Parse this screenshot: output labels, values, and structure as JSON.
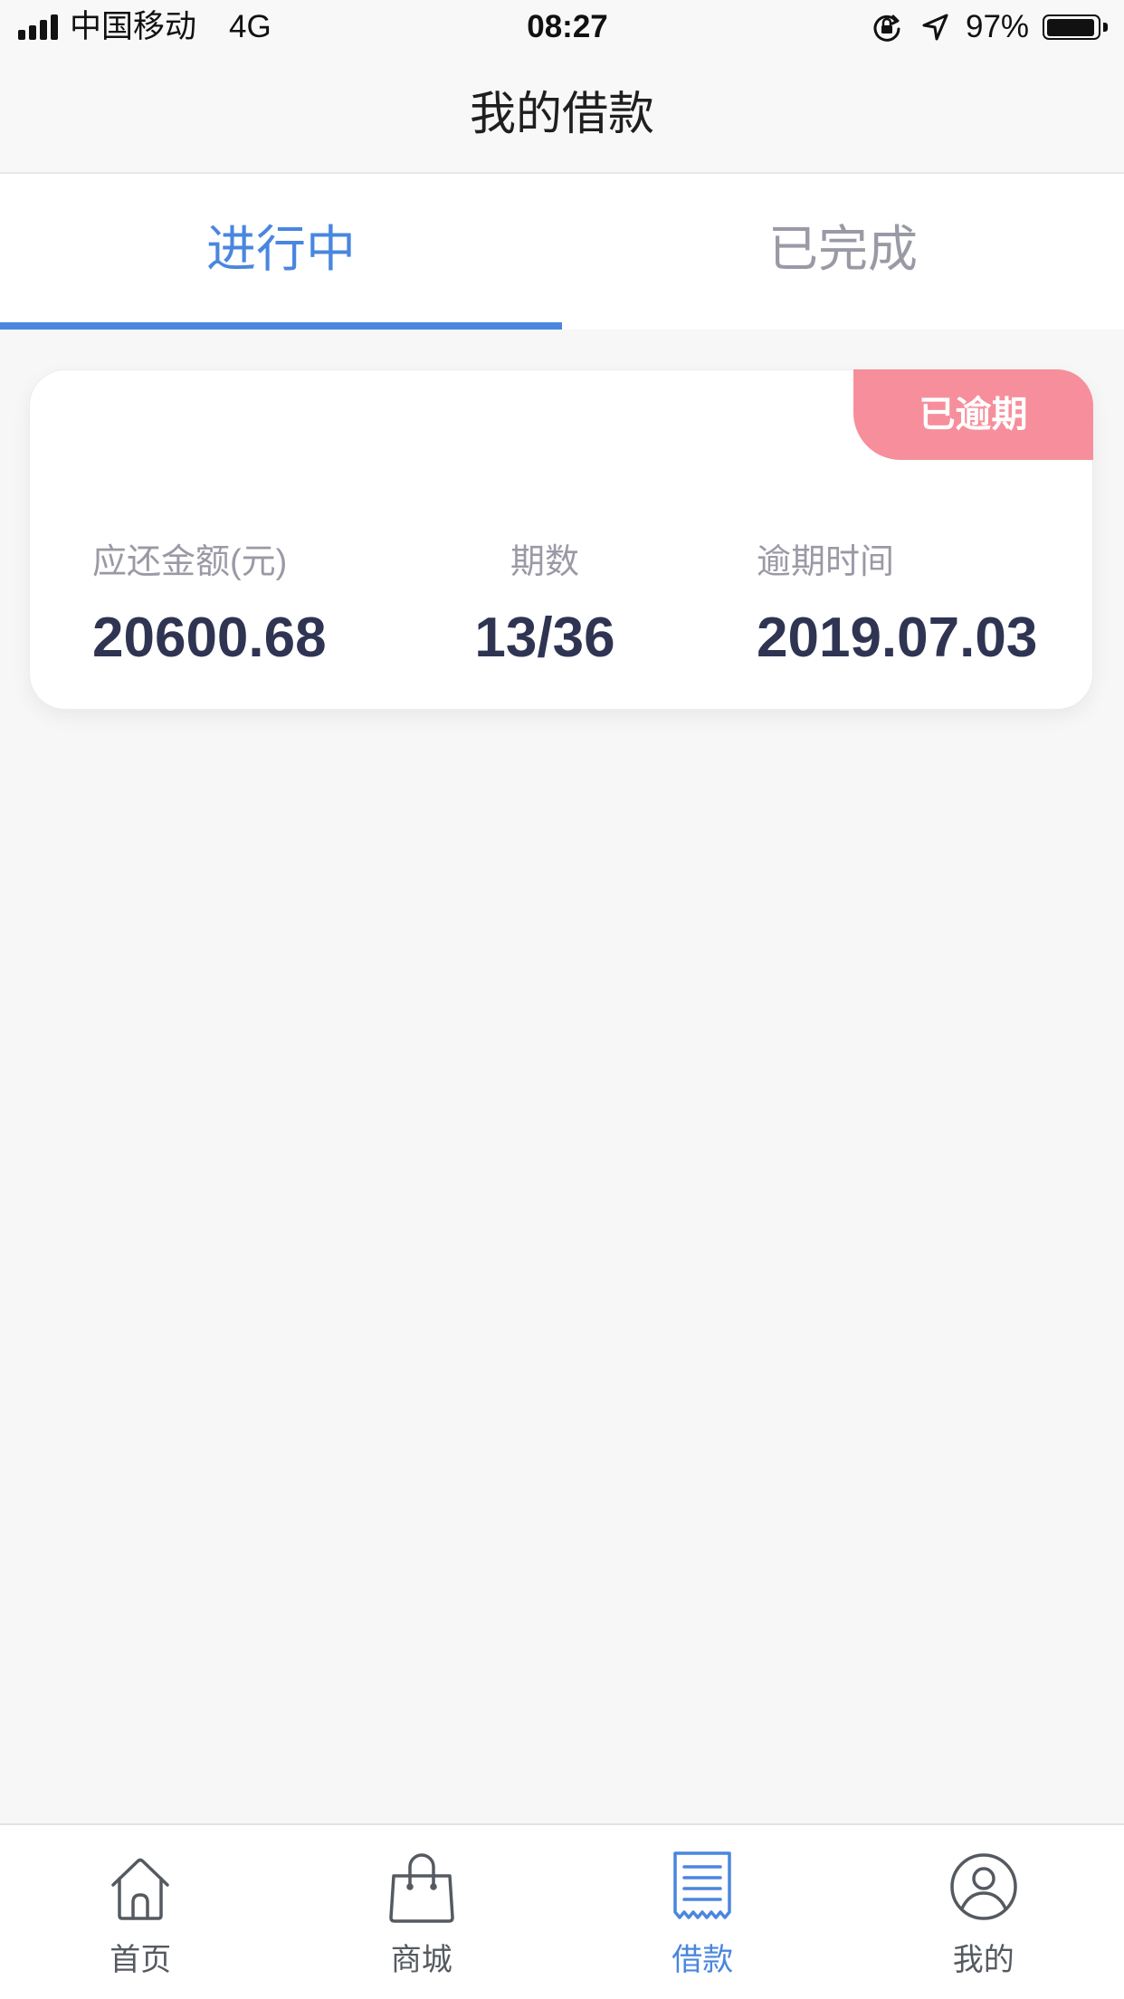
{
  "status_bar": {
    "carrier": "中国移动",
    "network": "4G",
    "time": "08:27",
    "battery_text": "97%",
    "battery_level": 0.97,
    "icons": [
      "signal-strength-icon",
      "orientation-lock-icon",
      "location-arrow-icon",
      "battery-icon"
    ]
  },
  "nav": {
    "title": "我的借款"
  },
  "tabs": [
    {
      "label": "进行中",
      "active": true
    },
    {
      "label": "已完成",
      "active": false
    }
  ],
  "loans": [
    {
      "status_badge": "已逾期",
      "amount_label": "应还金额(元)",
      "amount": "20600.68",
      "periods_label": "期数",
      "periods": "13/36",
      "overdue_label": "逾期时间",
      "overdue_date": "2019.07.03"
    }
  ],
  "tab_bar": {
    "items": [
      {
        "label": "首页",
        "icon": "home-icon",
        "active": false
      },
      {
        "label": "商城",
        "icon": "shopping-bag-icon",
        "active": false
      },
      {
        "label": "借款",
        "icon": "receipt-icon",
        "active": true
      },
      {
        "label": "我的",
        "icon": "profile-icon",
        "active": false
      }
    ]
  },
  "colors": {
    "accent": "#4a86df",
    "badge": "#f68f9b",
    "value_text": "#2f3452",
    "muted_text": "#9a9aa6",
    "page_background": "#f7f7f8"
  }
}
